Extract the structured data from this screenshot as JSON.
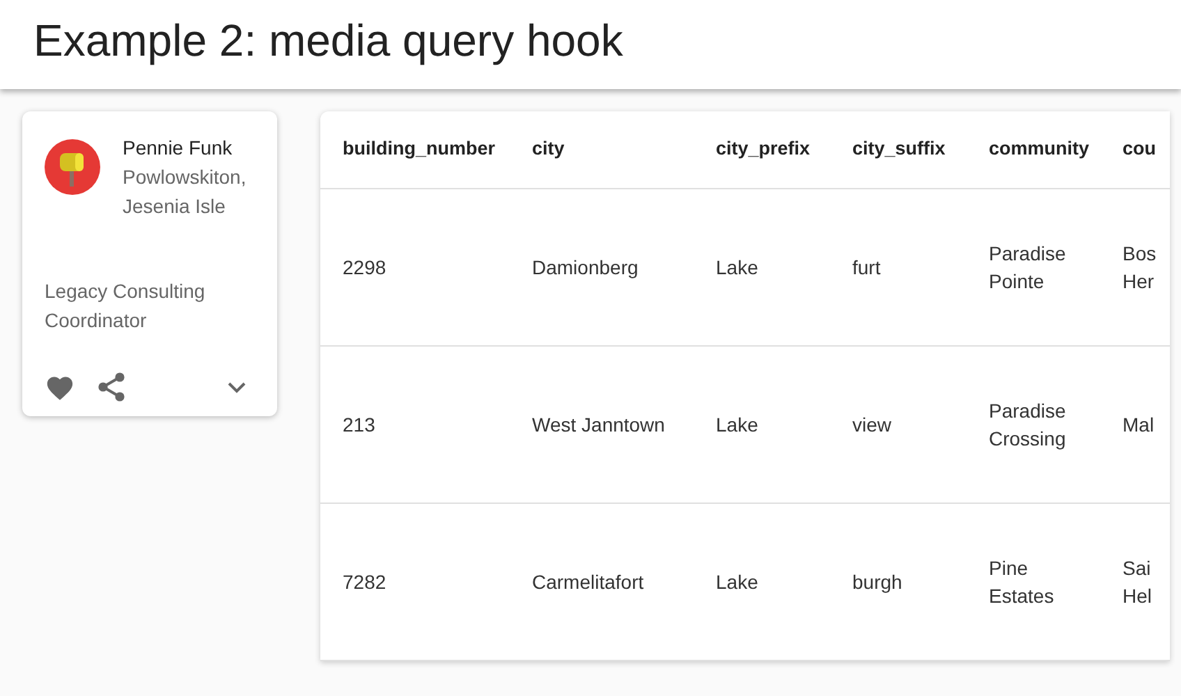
{
  "app_bar": {
    "title": "Example 2: media query hook"
  },
  "profile_card": {
    "name": "Pennie Funk",
    "address": "Powlowskiton, Jesenia Isle",
    "job_title": "Legacy Consulting Coordinator"
  },
  "table": {
    "columns": [
      "building_number",
      "city",
      "city_prefix",
      "city_suffix",
      "community",
      "cou"
    ],
    "rows": [
      [
        "2298",
        "Damionberg",
        "Lake",
        "furt",
        "Paradise Pointe",
        "Bos Her"
      ],
      [
        "213",
        "West Janntown",
        "Lake",
        "view",
        "Paradise Crossing",
        "Mal"
      ],
      [
        "7282",
        "Carmelitafort",
        "Lake",
        "burgh",
        "Pine Estates",
        "Sai Hel"
      ]
    ]
  }
}
